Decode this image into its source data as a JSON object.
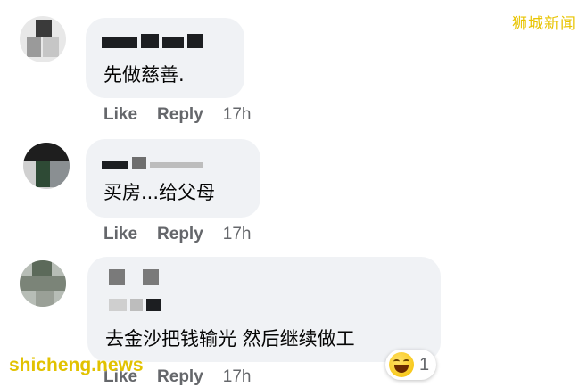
{
  "watermark": {
    "top": "狮城新闻",
    "bottom": "shicheng.news"
  },
  "comments": [
    {
      "text": "先做慈善.",
      "like": "Like",
      "reply": "Reply",
      "time": "17h"
    },
    {
      "text": "买房...给父母",
      "like": "Like",
      "reply": "Reply",
      "time": "17h"
    },
    {
      "text": "去金沙把钱输光 然后继续做工",
      "like": "Like",
      "reply": "Reply",
      "time": "17h",
      "reaction": {
        "icon": "laughing-emoji-icon",
        "count": "1"
      }
    }
  ],
  "colors": {
    "bubble": "#f0f2f5",
    "meta_text": "#65676b",
    "watermark": "#e8c400"
  }
}
